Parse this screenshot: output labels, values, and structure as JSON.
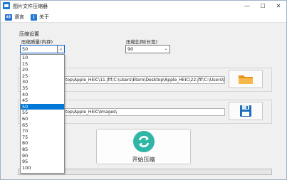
{
  "window": {
    "title": "图片文件压缩器"
  },
  "titlebar": {
    "minimize": "—",
    "maximize": "☐",
    "close": "✕"
  },
  "menu": {
    "language_icon": "A字",
    "language": "语言",
    "about_icon": "i",
    "about": "关于"
  },
  "settings": {
    "group_title": "压缩设置",
    "quality_label": "压缩质量(内存)",
    "quality_value": "50",
    "ratio_label": "压缩比例(长宽)",
    "ratio_value": "90"
  },
  "files": {
    "input_paths": "top\\Apple_HEIC\\11.jfif;C:\\Users\\Etern\\Desktop\\Apple_HEIC\\22.jfif;C:\\Users\\Etern",
    "output_path": "top\\Apple_HEIC\\Images\\"
  },
  "actions": {
    "start_label": "开始压缩"
  },
  "progress": {
    "fraction": 0
  },
  "quality_dropdown": {
    "options": [
      "10",
      "15",
      "20",
      "25",
      "30",
      "35",
      "40",
      "45",
      "50",
      "55",
      "60",
      "65",
      "70",
      "75",
      "80",
      "85",
      "90",
      "95",
      "100"
    ],
    "selected": "50"
  },
  "colors": {
    "accent": "#0078d7",
    "folder": "#f0a531",
    "save": "#1f6fbf",
    "start": "#2fb6a6"
  }
}
